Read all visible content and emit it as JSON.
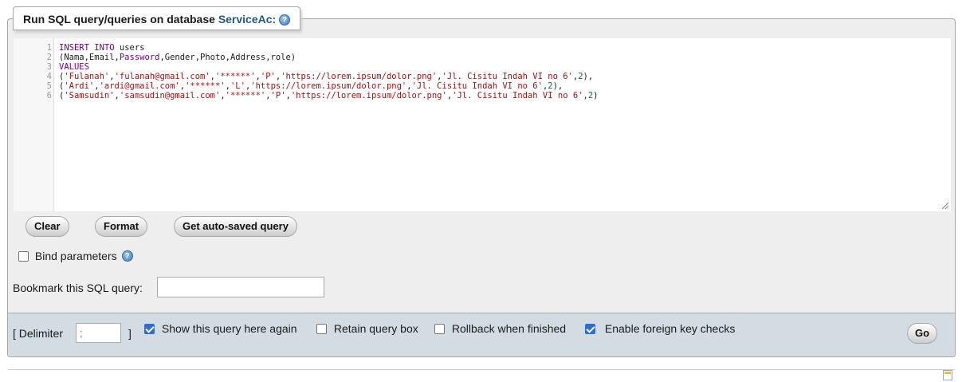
{
  "header": {
    "title_prefix": "Run SQL query/queries on database",
    "database": "ServiceAc:",
    "help_icon": "question-circle-icon"
  },
  "editor": {
    "lines": [
      {
        "n": "1",
        "tokens": [
          {
            "t": "INSERT INTO",
            "c": "kw"
          },
          {
            "t": " users",
            "c": ""
          }
        ]
      },
      {
        "n": "2",
        "tokens": [
          {
            "t": "(Nama,Email,",
            "c": ""
          },
          {
            "t": "Password",
            "c": "kw"
          },
          {
            "t": ",Gender,Photo,Address,role)",
            "c": ""
          }
        ]
      },
      {
        "n": "3",
        "tokens": [
          {
            "t": "VALUES",
            "c": "kw"
          }
        ]
      },
      {
        "n": "4",
        "tokens": [
          {
            "t": "(",
            "c": ""
          },
          {
            "t": "'Fulanah'",
            "c": "str"
          },
          {
            "t": ",",
            "c": ""
          },
          {
            "t": "'fulanah@gmail.com'",
            "c": "str"
          },
          {
            "t": ",",
            "c": ""
          },
          {
            "t": "'******'",
            "c": "str"
          },
          {
            "t": ",",
            "c": ""
          },
          {
            "t": "'P'",
            "c": "str"
          },
          {
            "t": ",",
            "c": ""
          },
          {
            "t": "'https://lorem.ipsum/dolor.png'",
            "c": "str"
          },
          {
            "t": ",",
            "c": ""
          },
          {
            "t": "'Jl. Cisitu Indah VI no 6'",
            "c": "str"
          },
          {
            "t": ",",
            "c": ""
          },
          {
            "t": "2",
            "c": "num"
          },
          {
            "t": "),",
            "c": ""
          }
        ]
      },
      {
        "n": "5",
        "tokens": [
          {
            "t": "(",
            "c": ""
          },
          {
            "t": "'Ardi'",
            "c": "str"
          },
          {
            "t": ",",
            "c": ""
          },
          {
            "t": "'ardi@gmail.com'",
            "c": "str"
          },
          {
            "t": ",",
            "c": ""
          },
          {
            "t": "'******'",
            "c": "str"
          },
          {
            "t": ",",
            "c": ""
          },
          {
            "t": "'L'",
            "c": "str"
          },
          {
            "t": ",",
            "c": ""
          },
          {
            "t": "'https://lorem.ipsum/dolor.png'",
            "c": "str"
          },
          {
            "t": ",",
            "c": ""
          },
          {
            "t": "'Jl. Cisitu Indah VI no 6'",
            "c": "str"
          },
          {
            "t": ",",
            "c": ""
          },
          {
            "t": "2",
            "c": "num"
          },
          {
            "t": "),",
            "c": ""
          }
        ]
      },
      {
        "n": "6",
        "tokens": [
          {
            "t": "(",
            "c": ""
          },
          {
            "t": "'Samsudin'",
            "c": "str"
          },
          {
            "t": ",",
            "c": ""
          },
          {
            "t": "'samsudin@gmail.com'",
            "c": "str"
          },
          {
            "t": ",",
            "c": ""
          },
          {
            "t": "'******'",
            "c": "str"
          },
          {
            "t": ",",
            "c": ""
          },
          {
            "t": "'P'",
            "c": "str"
          },
          {
            "t": ",",
            "c": ""
          },
          {
            "t": "'https://lorem.ipsum/dolor.png'",
            "c": "str"
          },
          {
            "t": ",",
            "c": ""
          },
          {
            "t": "'Jl. Cisitu Indah VI no 6'",
            "c": "str"
          },
          {
            "t": ",",
            "c": ""
          },
          {
            "t": "2",
            "c": "num"
          },
          {
            "t": ")",
            "c": ""
          }
        ]
      }
    ]
  },
  "buttons": {
    "clear": "Clear",
    "format": "Format",
    "autosaved": "Get auto-saved query",
    "go": "Go"
  },
  "bind_parameters": {
    "label": "Bind parameters",
    "checked": false
  },
  "bookmark": {
    "label": "Bookmark this SQL query:",
    "value": ""
  },
  "options": {
    "delimiter_open": "[ Delimiter",
    "delimiter_value": ";",
    "delimiter_close": "]",
    "show_query": {
      "label": "Show this query here again",
      "checked": true
    },
    "retain_box": {
      "label": "Retain query box",
      "checked": false
    },
    "rollback": {
      "label": "Rollback when finished",
      "checked": false
    },
    "foreign_keys": {
      "label": "Enable foreign key checks",
      "checked": true
    }
  },
  "colors": {
    "keyword": "#770088",
    "string": "#aa1111",
    "number": "#116644",
    "database_link": "#235a81",
    "checkbox_checked": "#2c6ed4",
    "bottom_bar": "#d3dce3"
  }
}
